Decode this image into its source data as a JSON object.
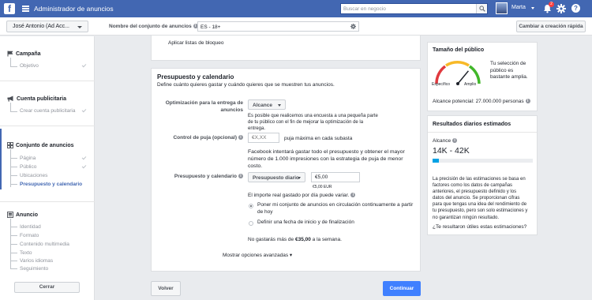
{
  "topbar": {
    "logo": "f",
    "title": "Administrador de anuncios",
    "search_placeholder": "Buscar en negocio",
    "user_name": "Marta",
    "notification_count": "2",
    "help_glyph": "?"
  },
  "subheader": {
    "account": "José Antonio (Ad Acc...",
    "adset_label": "Nombre del conjunto de anuncios",
    "adset_value": "ES - 18+",
    "quick_creation": "Cambiar a creación rápida"
  },
  "sidebar": {
    "campaign": {
      "title": "Campaña",
      "items": [
        "Objetivo"
      ]
    },
    "ad_account": {
      "title": "Cuenta publicitaria",
      "items": [
        "Crear cuenta publicitaria"
      ]
    },
    "adset": {
      "title": "Conjunto de anuncios",
      "items": [
        "Página",
        "Público",
        "Ubicaciones",
        "Presupuesto y calendario"
      ]
    },
    "ad": {
      "title": "Anuncio",
      "items": [
        "Identidad",
        "Formato",
        "Contenido multimedia",
        "Texto",
        "Varios idiomas",
        "Seguimiento"
      ]
    },
    "close_label": "Cerrar"
  },
  "main": {
    "blocklist_link": "Aplicar listas de bloqueo",
    "budget": {
      "title": "Presupuesto y calendario",
      "subtitle": "Define cuánto quieres gastar y cuándo quieres que se muestren tus anuncios.",
      "optimization_label": [
        "Optimización para la entrega de",
        "anuncios"
      ],
      "optimization_value": "Alcance",
      "optimization_help": [
        "Es posible que realicemos una encuesta a una pequeña parte",
        "de tu público con el fin de mejorar la optimización de la",
        "entrega."
      ],
      "bid_label": "Control de puja (opcional)",
      "bid_placeholder": "€X,XX",
      "bid_suffix": "puja máxima en cada subasta",
      "bid_help": [
        "Facebook intentará gastar todo el presupuesto y obtener el mayor",
        "número de 1.000 impresiones con la estrategia de puja de menor",
        "costo."
      ],
      "budget_label": "Presupuesto y calendario",
      "budget_type": "Presupuesto diario",
      "budget_value": "€5,00",
      "budget_currency": "€5,00 EUR",
      "real_spend_note": "El importe real gastado por día puede variar.",
      "schedule_options": [
        [
          "Poner mi conjunto de anuncios en circulación continuamente a partir",
          "de hoy"
        ],
        [
          "Definir una fecha de inicio y de finalización"
        ]
      ],
      "weekly_note_prefix": "No gastarás más de ",
      "weekly_amount": "€35,00",
      "weekly_note_suffix": " a la semana.",
      "advanced_link": "Mostrar opciones avanzadas ▾"
    }
  },
  "footer": {
    "back": "Volver",
    "continue": "Continuar"
  },
  "audience": {
    "title": "Tamaño del público",
    "specific": "Específico",
    "broad": "Amplio",
    "description": [
      "Tu selección de",
      "público es",
      "bastante amplia."
    ],
    "reach_label": "Alcance potencial: ",
    "reach_value": "27.000.000 personas",
    "gauge_position": 0.72
  },
  "estimates": {
    "title": "Resultados diarios estimados",
    "reach_label": "Alcance",
    "reach_range": "14K - 42K",
    "reach_fill": 0.06,
    "disclaimer": [
      "La precisión de las estimaciones se basa en",
      "factores como los datos de campañas",
      "anteriores, el presupuesto definido y los",
      "datos del anuncio. Se proporcionan cifras",
      "para que tengas una idea del rendimiento de",
      "tu presupuesto, pero son solo estimaciones y",
      "no garantizan ningún resultado."
    ],
    "feedback_link": "¿Te resultaron útiles estas estimaciones?"
  },
  "colors": {
    "brand": "#4267b2",
    "continue": "#4080ff",
    "gauge_red": "#e0393e",
    "gauge_yellow": "#f7b928",
    "gauge_green": "#42b72a",
    "reach_bar": "#00a1e4"
  }
}
